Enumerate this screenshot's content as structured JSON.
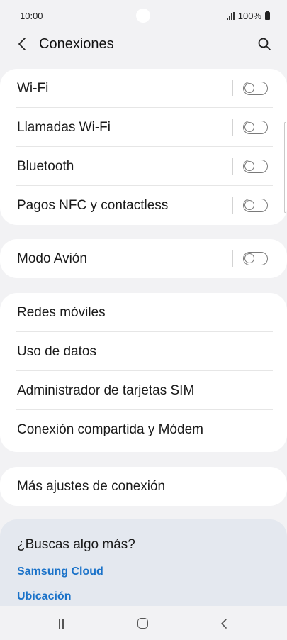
{
  "status_bar": {
    "time": "10:00",
    "battery": "100%",
    "icons": [
      "signal-icon",
      "battery-icon"
    ]
  },
  "header": {
    "title": "Conexiones",
    "icons": [
      "back-icon",
      "search-icon"
    ]
  },
  "group1": {
    "items": [
      {
        "label": "Wi-Fi",
        "toggle": "off"
      },
      {
        "label": "Llamadas Wi-Fi",
        "toggle": "off"
      },
      {
        "label": "Bluetooth",
        "toggle": "off"
      },
      {
        "label": "Pagos NFC y contactless",
        "toggle": "off"
      }
    ]
  },
  "group2": {
    "items": [
      {
        "label": "Modo Avión",
        "toggle": "off"
      }
    ]
  },
  "group3": {
    "items": [
      {
        "label": "Redes móviles"
      },
      {
        "label": "Uso de datos"
      },
      {
        "label": "Administrador de tarjetas SIM"
      },
      {
        "label": "Conexión compartida y Módem"
      }
    ]
  },
  "group4": {
    "items": [
      {
        "label": "Más ajustes de conexión"
      }
    ]
  },
  "suggestions": {
    "title": "¿Buscas algo más?",
    "links": [
      "Samsung Cloud",
      "Ubicación"
    ]
  },
  "nav_bar": {
    "icons": [
      "recent-apps-icon",
      "home-icon",
      "back-icon"
    ]
  },
  "colors": {
    "background": "#f2f2f4",
    "card": "#ffffff",
    "suggest_card": "#e4e8ef",
    "link": "#1a72c9"
  }
}
